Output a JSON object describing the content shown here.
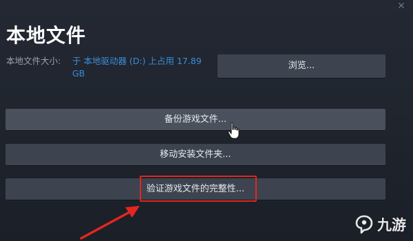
{
  "window": {
    "close_glyph": "✕"
  },
  "header": {
    "title": "本地文件"
  },
  "disk_usage": {
    "label": "本地文件大小:",
    "value": "于 本地驱动器 (D:) 上占用 17.89 GB"
  },
  "buttons": {
    "browse": "浏览...",
    "backup": "备份游戏文件...",
    "move": "移动安装文件夹...",
    "verify": "验证游戏文件的完整性..."
  },
  "annotation": {
    "highlight_color": "#e3261f",
    "arrow_color": "#e3261f"
  },
  "watermark": {
    "text": "九游",
    "icon": "jiuyou-logo-icon"
  },
  "colors": {
    "background": "#20252e",
    "button": "#3d4450",
    "link_blue": "#3a8fd9"
  }
}
